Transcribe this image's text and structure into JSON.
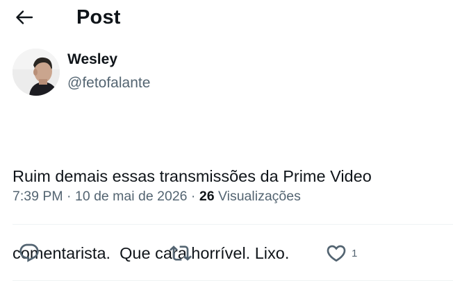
{
  "header": {
    "title": "Post",
    "back_icon": "arrow-left-icon"
  },
  "author": {
    "name": "Wesley",
    "handle": "@fetofalante",
    "avatar_icon": "user-avatar"
  },
  "post": {
    "text_line1": "Ruim demais essas transmissões da Prime Video",
    "text_line2": "comentarista.  Que cara horrível. Lixo."
  },
  "meta": {
    "time": "7:39 PM",
    "separator": " · ",
    "date": "10 de mai de 2026",
    "views_count": "26",
    "views_label": " Visualizações"
  },
  "actions": {
    "reply_icon": "reply-icon",
    "repost_icon": "repost-icon",
    "like_icon": "heart-icon",
    "like_count": "1"
  },
  "colors": {
    "text": "#0f1419",
    "secondary": "#536471",
    "divider": "#eff3f4"
  }
}
